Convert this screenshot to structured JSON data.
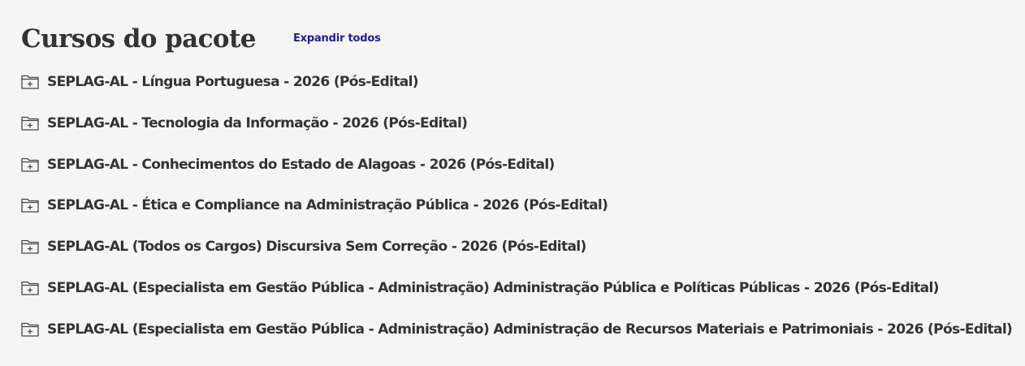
{
  "section": {
    "title": "Cursos do pacote",
    "expand_all_label": "Expandir todos"
  },
  "courses": [
    {
      "label": "SEPLAG-AL - Língua Portuguesa - 2026 (Pós-Edital)",
      "icon": "folder-plus-icon"
    },
    {
      "label": "SEPLAG-AL - Tecnologia da Informação - 2026 (Pós-Edital)",
      "icon": "folder-plus-icon"
    },
    {
      "label": "SEPLAG-AL - Conhecimentos do Estado de Alagoas - 2026 (Pós-Edital)",
      "icon": "folder-plus-icon"
    },
    {
      "label": "SEPLAG-AL - Ética e Compliance na Administração Pública - 2026 (Pós-Edital)",
      "icon": "folder-plus-icon"
    },
    {
      "label": "SEPLAG-AL (Todos os Cargos) Discursiva Sem Correção - 2026 (Pós-Edital)",
      "icon": "folder-plus-icon"
    },
    {
      "label": "SEPLAG-AL (Especialista em Gestão Pública - Administração) Administração Pública e Políticas Públicas - 2026 (Pós-Edital)",
      "icon": "folder-plus-icon"
    },
    {
      "label": "SEPLAG-AL (Especialista em Gestão Pública - Administração) Administração de Recursos Materiais e Patrimoniais - 2026 (Pós-Edital)",
      "icon": "folder-plus-icon"
    }
  ],
  "colors": {
    "background": "#f5f5f5",
    "text": "#333333",
    "link": "#1e1e96"
  }
}
